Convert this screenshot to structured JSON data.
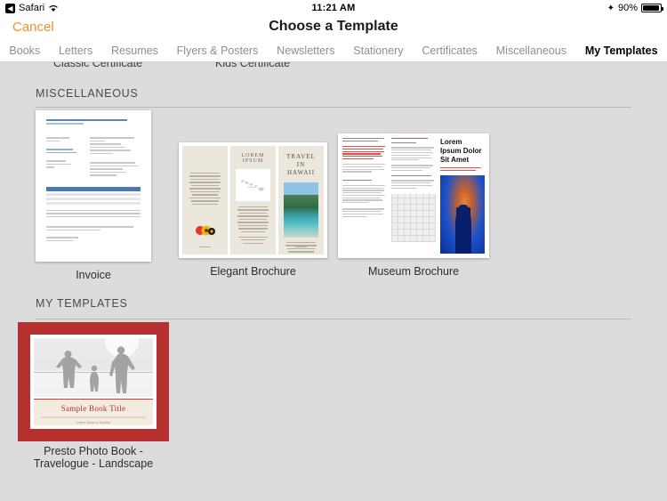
{
  "statusbar": {
    "back_app": "Safari",
    "back_icon": "chevron-left-icon",
    "wifi_icon": "wifi-icon",
    "time": "11:21 AM",
    "bluetooth_icon": "bluetooth-icon",
    "battery_percent": "90%",
    "battery_icon": "battery-icon"
  },
  "navbar": {
    "cancel_label": "Cancel",
    "title": "Choose a Template"
  },
  "tabs": [
    {
      "label": "Books",
      "active": false
    },
    {
      "label": "Letters",
      "active": false
    },
    {
      "label": "Resumes",
      "active": false
    },
    {
      "label": "Flyers & Posters",
      "active": false
    },
    {
      "label": "Newsletters",
      "active": false
    },
    {
      "label": "Stationery",
      "active": false
    },
    {
      "label": "Certificates",
      "active": false
    },
    {
      "label": "Miscellaneous",
      "active": false
    },
    {
      "label": "My Templates",
      "active": true
    }
  ],
  "clipped_row": {
    "label_1": "Classic Certificate",
    "label_2": "Kids Certificate"
  },
  "sections": [
    {
      "header": "MISCELLANEOUS",
      "templates": [
        {
          "name": "Invoice"
        },
        {
          "name": "Elegant Brochure"
        },
        {
          "name": "Museum Brochure"
        }
      ]
    },
    {
      "header": "MY TEMPLATES",
      "templates": [
        {
          "name": "Presto Photo Book -\nTravelogue - Landscape",
          "selected": true
        }
      ]
    }
  ],
  "thumbnails": {
    "elegant_brochure": {
      "panel_middle_title": "LOREM IPSUM",
      "panel_right_title": "TRAVEL IN\nHAWAII"
    },
    "museum_brochure": {
      "panel_right_title": "Lorem Ipsum\nDolor Sit Amet"
    },
    "presto_photo_book": {
      "title": "Sample Book Title",
      "subtitle": "Author Name or Subtitle"
    }
  },
  "colors": {
    "accent_orange": "#f0922b",
    "selection_red": "#b5302f",
    "background_gray": "#dcdcdc",
    "bar_white": "#ffffff",
    "tab_inactive": "#8e8e93"
  }
}
